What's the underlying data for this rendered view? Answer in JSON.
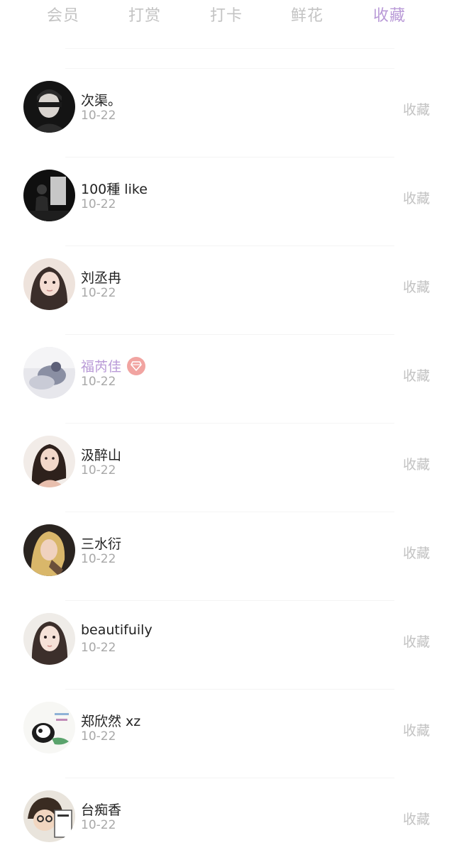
{
  "tabs": [
    {
      "label": "会员",
      "active": false
    },
    {
      "label": "打赏",
      "active": false
    },
    {
      "label": "打卡",
      "active": false
    },
    {
      "label": "鲜花",
      "active": false
    },
    {
      "label": "收藏",
      "active": true
    }
  ],
  "colors": {
    "accent": "#b99ad7",
    "tab_inactive": "#c3c3c3",
    "name": "#222222",
    "date": "#a8a8a8",
    "action": "#c2c2c2",
    "vip_badge": "#f1a4a1"
  },
  "list": [
    {
      "name": "次渠。",
      "date": "10-22",
      "action": "收藏",
      "vip": false,
      "avatar": "masked-portrait-dark"
    },
    {
      "name": "100種 like",
      "date": "10-22",
      "action": "收藏",
      "vip": false,
      "avatar": "silhouette-dark"
    },
    {
      "name": "刘丞冉",
      "date": "10-22",
      "action": "收藏",
      "vip": false,
      "avatar": "girl-portrait"
    },
    {
      "name": "福芮佳",
      "date": "10-22",
      "action": "收藏",
      "vip": true,
      "avatar": "blurred-photo"
    },
    {
      "name": "汲醉山",
      "date": "10-22",
      "action": "收藏",
      "vip": false,
      "avatar": "woman-portrait"
    },
    {
      "name": "三水衍",
      "date": "10-22",
      "action": "收藏",
      "vip": false,
      "avatar": "blonde-portrait"
    },
    {
      "name": "beautifuily",
      "date": "10-22",
      "action": "收藏",
      "vip": false,
      "avatar": "illustrated-girl"
    },
    {
      "name": "郑欣然 xz",
      "date": "10-22",
      "action": "收藏",
      "vip": false,
      "avatar": "panda-sticker"
    },
    {
      "name": "台痴香",
      "date": "10-22",
      "action": "收藏",
      "vip": false,
      "avatar": "cartoon-menu"
    }
  ]
}
